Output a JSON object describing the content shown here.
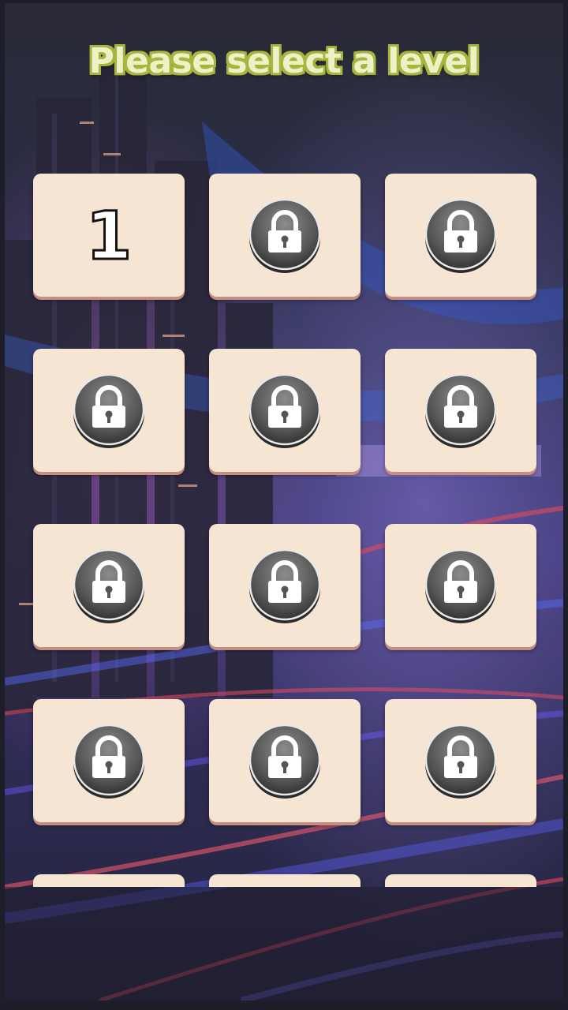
{
  "title": "Please select a level",
  "colors": {
    "title_fill": "#eef0c6",
    "title_outline": "#a5b53e",
    "tile_bg": "#f6e5d3",
    "tile_shadow": "#c58e83"
  },
  "levels": [
    {
      "label": "1",
      "locked": false
    },
    {
      "label": "",
      "locked": true,
      "icon": "lock-icon"
    },
    {
      "label": "",
      "locked": true,
      "icon": "lock-icon"
    },
    {
      "label": "",
      "locked": true,
      "icon": "lock-icon"
    },
    {
      "label": "",
      "locked": true,
      "icon": "lock-icon"
    },
    {
      "label": "",
      "locked": true,
      "icon": "lock-icon"
    },
    {
      "label": "",
      "locked": true,
      "icon": "lock-icon"
    },
    {
      "label": "",
      "locked": true,
      "icon": "lock-icon"
    },
    {
      "label": "",
      "locked": true,
      "icon": "lock-icon"
    },
    {
      "label": "",
      "locked": true,
      "icon": "lock-icon"
    },
    {
      "label": "",
      "locked": true,
      "icon": "lock-icon"
    },
    {
      "label": "",
      "locked": true,
      "icon": "lock-icon"
    },
    {
      "label": "",
      "locked": true,
      "icon": "lock-icon"
    },
    {
      "label": "",
      "locked": true,
      "icon": "lock-icon"
    },
    {
      "label": "",
      "locked": true,
      "icon": "lock-icon"
    }
  ]
}
